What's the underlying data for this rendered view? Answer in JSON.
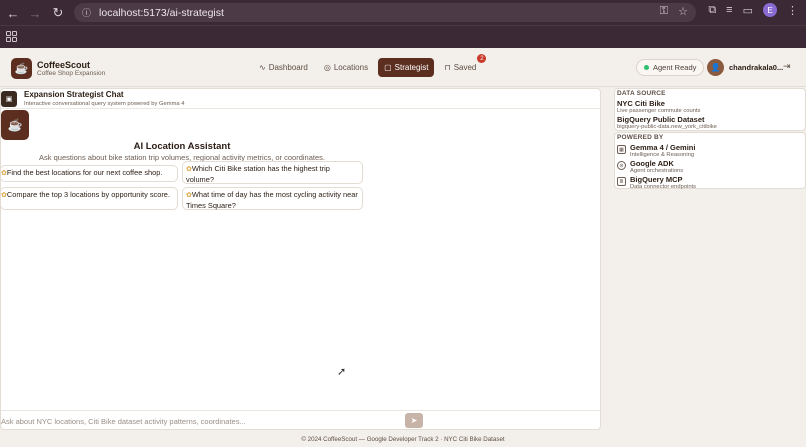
{
  "browser": {
    "url": "localhost:5173/ai-strategist",
    "profile_initial": "E"
  },
  "header": {
    "brand_name": "CoffeeScout",
    "brand_sub": "Coffee Shop Expansion",
    "nav": [
      {
        "label": "Dashboard",
        "icon": "activity-icon"
      },
      {
        "label": "Locations",
        "icon": "map-pin-icon"
      },
      {
        "label": "Strategist",
        "icon": "message-icon",
        "active": true
      },
      {
        "label": "Saved",
        "icon": "bookmark-icon",
        "badge": "2"
      }
    ],
    "agent_status": "Agent Ready",
    "username": "chandrakala0..."
  },
  "chat": {
    "title": "Expansion Strategist Chat",
    "subtitle": "Interactive conversational query system powered by Gemma 4",
    "assistant_title": "AI Location Assistant",
    "assistant_sub": "Ask questions about bike station trip volumes, regional activity metrics, or coordinates.",
    "suggestions": [
      "Find the best locations for our next coffee shop.",
      "Which Citi Bike station has the highest trip volume?",
      "Compare the top 3 locations by opportunity score.",
      "What time of day has the most cycling activity near Times Square?"
    ],
    "input_placeholder": "Ask about NYC locations, Citi Bike dataset activity patterns, coordinates..."
  },
  "sidebar": {
    "data_source_title": "DATA SOURCE",
    "sources": [
      {
        "name": "NYC Citi Bike",
        "sub": "Live passenger commute counts"
      },
      {
        "name": "BigQuery Public Dataset",
        "sub": "bigquery-public-data.new_york_citibike"
      }
    ],
    "powered_by_title": "POWERED BY",
    "powered": [
      {
        "name": "Gemma 4 / Gemini",
        "sub": "Intelligence & Reasoning",
        "icon": "chip-icon"
      },
      {
        "name": "Google ADK",
        "sub": "Agent orchestrations",
        "icon": "compass-icon"
      },
      {
        "name": "BigQuery MCP",
        "sub": "Data connector endpoints",
        "icon": "database-icon"
      }
    ]
  },
  "footer": "© 2024 CoffeeScout — Google Developer Track 2 · NYC Citi Bike Dataset"
}
